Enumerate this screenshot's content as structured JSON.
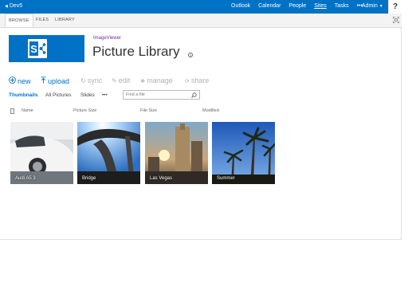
{
  "suite_bar": {
    "site": "Dev5",
    "links": [
      "Outlook",
      "Calendar",
      "People",
      "Sites",
      "Tasks",
      "•••"
    ],
    "active_link": "Sites",
    "user": "Admin",
    "help": "?"
  },
  "ribbon": {
    "tabs": [
      "BROWSE",
      "FILES",
      "LIBRARY"
    ],
    "selected_tab": "BROWSE"
  },
  "header": {
    "site_link": "ImageViewer",
    "title": "Picture Library"
  },
  "commands": [
    {
      "label": "new",
      "icon": "plus-circle-icon",
      "enabled": true
    },
    {
      "label": "upload",
      "icon": "upload-icon",
      "enabled": true
    },
    {
      "label": "sync",
      "icon": "sync-icon",
      "enabled": false
    },
    {
      "label": "edit",
      "icon": "pencil-icon",
      "enabled": false
    },
    {
      "label": "manage",
      "icon": "wrench-icon",
      "enabled": false
    },
    {
      "label": "share",
      "icon": "share-icon",
      "enabled": false
    }
  ],
  "views": {
    "items": [
      "Thumbnails",
      "All Pictures",
      "Slides",
      "•••"
    ],
    "selected": "Thumbnails"
  },
  "search": {
    "placeholder": "Find a file"
  },
  "columns": [
    "Name",
    "Picture Size",
    "File Size",
    "Modified"
  ],
  "pictures": [
    {
      "name": "Audi A5 3"
    },
    {
      "name": "Bridge"
    },
    {
      "name": "Las Vegas"
    },
    {
      "name": "Summer"
    }
  ],
  "colors": {
    "accent": "#0072c6",
    "site_link": "#7a2a95"
  }
}
